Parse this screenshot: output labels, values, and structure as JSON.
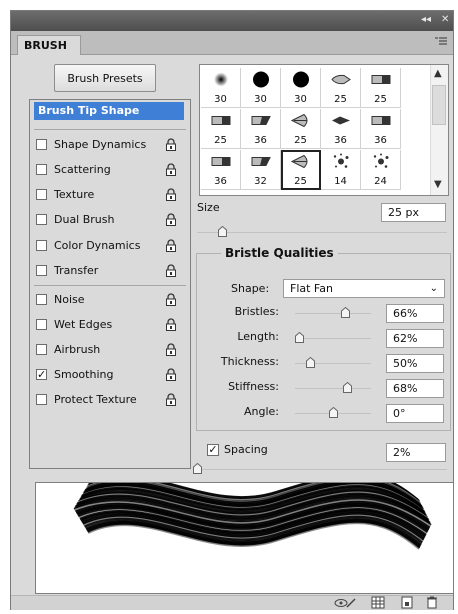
{
  "window": {
    "collapse_label": "◂◂",
    "close_label": "✕"
  },
  "tab": {
    "label": "BRUSH",
    "menu_icon": "panel-menu-icon"
  },
  "presets_button": {
    "label": "Brush Presets"
  },
  "options": [
    {
      "label": "Brush Tip Shape",
      "selected": true
    },
    {
      "label": "Shape Dynamics",
      "checked": false,
      "locked": true
    },
    {
      "label": "Scattering",
      "checked": false,
      "locked": true
    },
    {
      "label": "Texture",
      "checked": false,
      "locked": true
    },
    {
      "label": "Dual Brush",
      "checked": false,
      "locked": true
    },
    {
      "label": "Color Dynamics",
      "checked": false,
      "locked": true
    },
    {
      "label": "Transfer",
      "checked": false,
      "locked": true
    },
    {
      "label": "Noise",
      "checked": false,
      "locked": true
    },
    {
      "label": "Wet Edges",
      "checked": false,
      "locked": true
    },
    {
      "label": "Airbrush",
      "checked": false,
      "locked": true
    },
    {
      "label": "Smoothing",
      "checked": true,
      "locked": true
    },
    {
      "label": "Protect Texture",
      "checked": false,
      "locked": true
    }
  ],
  "tips": [
    {
      "size": "30",
      "shape": "soft-round"
    },
    {
      "size": "30",
      "shape": "hard-round"
    },
    {
      "size": "30",
      "shape": "hard-round"
    },
    {
      "size": "25",
      "shape": "bristle-round"
    },
    {
      "size": "25",
      "shape": "bristle-flat"
    },
    {
      "size": "25",
      "shape": "bristle-flat"
    },
    {
      "size": "36",
      "shape": "bristle-angle"
    },
    {
      "size": "25",
      "shape": "bristle-fan"
    },
    {
      "size": "36",
      "shape": "bristle-point"
    },
    {
      "size": "36",
      "shape": "bristle-flat"
    },
    {
      "size": "36",
      "shape": "bristle-flat"
    },
    {
      "size": "32",
      "shape": "bristle-angle"
    },
    {
      "size": "25",
      "shape": "bristle-fan",
      "selected": true
    },
    {
      "size": "14",
      "shape": "splatter"
    },
    {
      "size": "24",
      "shape": "splatter"
    }
  ],
  "size": {
    "label": "Size",
    "value": "25 px",
    "slider_fraction": 0.1
  },
  "bristle": {
    "title": "Bristle Qualities",
    "shape_label": "Shape:",
    "shape_value": "Flat Fan",
    "rows": [
      {
        "label": "Bristles:",
        "value": "66%",
        "slider_fraction": 0.66
      },
      {
        "label": "Length:",
        "value": "62%",
        "slider_fraction": 0.05
      },
      {
        "label": "Thickness:",
        "value": "50%",
        "slider_fraction": 0.2
      },
      {
        "label": "Stiffness:",
        "value": "68%",
        "slider_fraction": 0.68
      },
      {
        "label": "Angle:",
        "value": "0°",
        "slider_fraction": 0.5
      }
    ]
  },
  "spacing": {
    "label": "Spacing",
    "value": "2%",
    "checked": true,
    "slider_fraction": 0.0
  },
  "bottom_icons": [
    "eye-brush-icon",
    "grid-icon",
    "new-preset-icon",
    "trash-icon"
  ]
}
